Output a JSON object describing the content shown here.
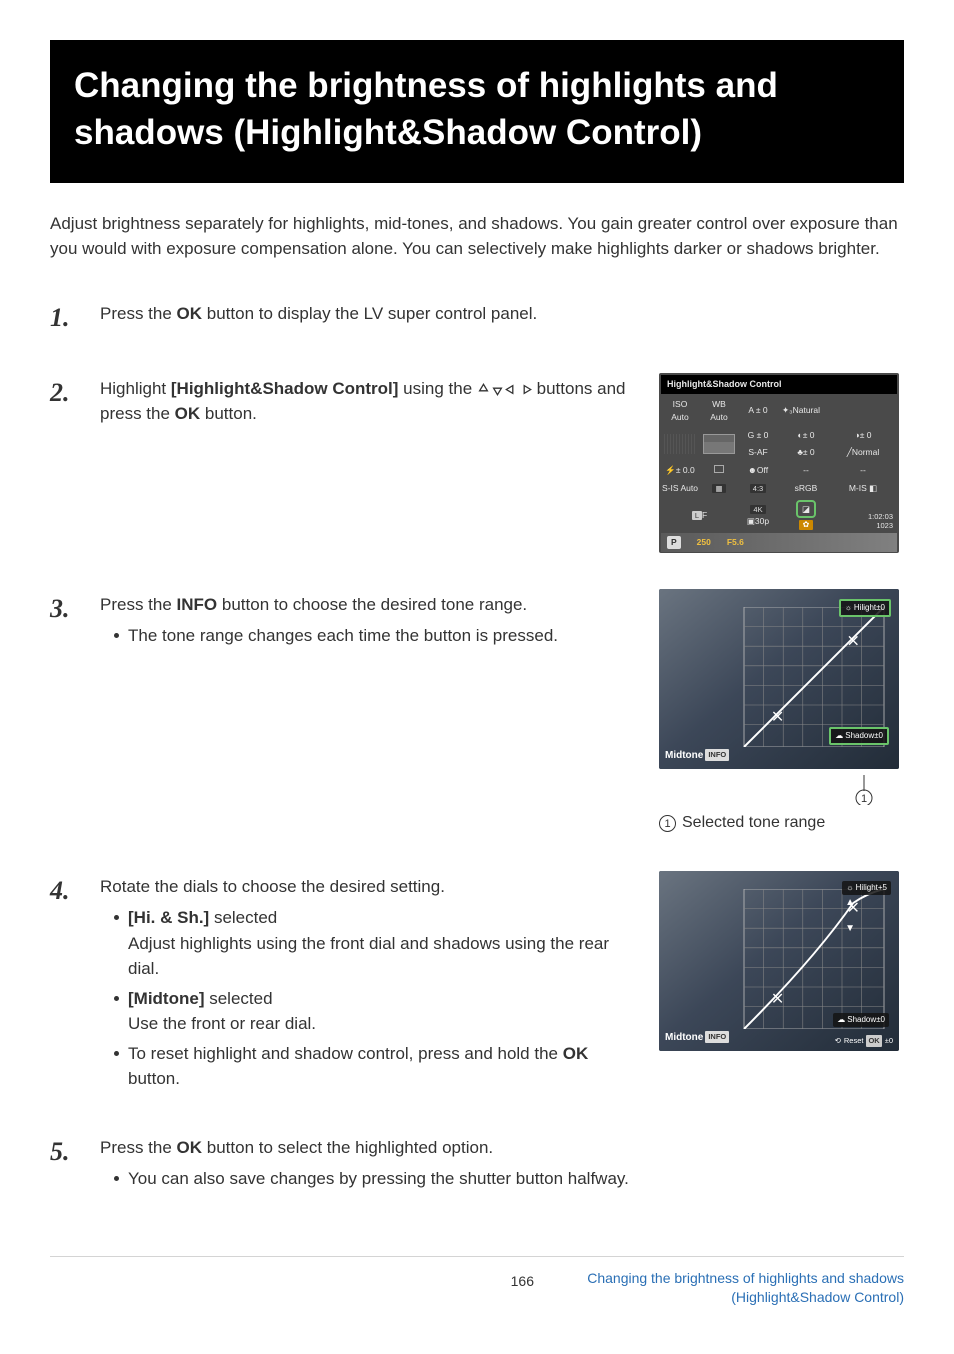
{
  "title": "Changing the brightness of highlights and shadows (Highlight&Shadow Control)",
  "intro": "Adjust brightness separately for highlights, mid-tones, and shadows. You gain greater control over exposure than you would with exposure compensation alone. You can selectively make highlights darker or shadows brighter.",
  "steps": {
    "s1": {
      "num": "1.",
      "text_a": "Press the ",
      "text_b": "OK",
      "text_c": " button to display the LV super control panel."
    },
    "s2": {
      "num": "2.",
      "text_a": "Highlight ",
      "text_b": "[Highlight&Shadow Control]",
      "text_c": " using the ",
      "text_d": " buttons and press the ",
      "text_e": "OK",
      "text_f": " button."
    },
    "s3": {
      "num": "3.",
      "text_a": "Press the ",
      "text_b": "INFO",
      "text_c": " button to choose the desired tone range.",
      "bullet1": "The tone range changes each time the button is pressed.",
      "caption_num": "1",
      "caption_text": "Selected tone range"
    },
    "s4": {
      "num": "4.",
      "text_main": "Rotate the dials to choose the desired setting.",
      "b1_label": "[Hi. & Sh.]",
      "b1_sel": " selected",
      "b1_body": "Adjust highlights using the front dial and shadows using the rear dial.",
      "b2_label": "[Midtone]",
      "b2_sel": " selected",
      "b2_body": "Use the front or rear dial.",
      "b3_a": "To reset highlight and shadow control, press and hold the ",
      "b3_b": "OK",
      "b3_c": " button."
    },
    "s5": {
      "num": "5.",
      "text_a": "Press the ",
      "text_b": "OK",
      "text_c": " button to select the highlighted option.",
      "bullet1": "You can also save changes by pressing the shutter button halfway."
    }
  },
  "lv_panel": {
    "header": "Highlight&Shadow Control",
    "iso_label": "ISO",
    "iso_value": "Auto",
    "wb_label": "WB",
    "wb_value": "Auto",
    "a_comp": "A ± 0",
    "g_comp": "G ± 0",
    "natural": "Natural",
    "s_af": "S-AF",
    "face_off": "Off",
    "contrast": "± 0",
    "saturation": "± 0",
    "sharpness": "± 0",
    "normal": "Normal",
    "flash_comp": "± 0.0",
    "aspect": "4:3",
    "srgb": "sRGB",
    "s_is": "S-IS Auto",
    "m_is": "M-IS",
    "lf": "F",
    "l_badge": "L",
    "movie": "4K",
    "fps": "30p",
    "p_mode": "P",
    "shutter": "250",
    "aperture": "F5.6",
    "time": "1:02:03",
    "frames": "1023"
  },
  "curve_panel_a": {
    "hilite": "Hilight±0",
    "shadow": "Shadow±0",
    "midtone": "Midtone",
    "info": "INFO"
  },
  "curve_panel_b": {
    "hilite": "Hilight+5",
    "shadow": "Shadow±0",
    "midtone": "Midtone",
    "info": "INFO",
    "reset": "Reset",
    "ok": "OK",
    "ok_val": "±0"
  },
  "footer": {
    "page": "166",
    "link": "Changing the brightness of highlights and shadows (Highlight&Shadow Control)"
  }
}
